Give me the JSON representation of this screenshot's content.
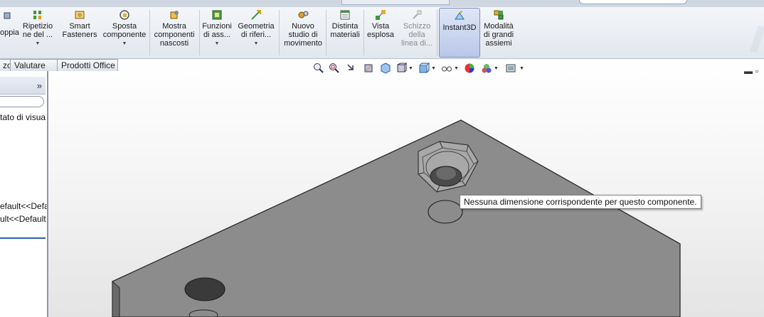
{
  "ribbon": {
    "buttons": [
      {
        "id": "accoppia",
        "label": "oppia"
      },
      {
        "id": "ripetizione",
        "label": "Ripetizio\nne del ..."
      },
      {
        "id": "smart-fasteners",
        "label": "Smart\nFasteners"
      },
      {
        "id": "sposta-componente",
        "label": "Sposta\ncomponente"
      },
      {
        "id": "mostra-componenti-nascosti",
        "label": "Mostra\ncomponenti\nnascosti"
      },
      {
        "id": "funzioni-assieme",
        "label": "Funzioni\ndi ass..."
      },
      {
        "id": "geometria-riferimento",
        "label": "Geometria\ndi riferi..."
      },
      {
        "id": "nuovo-studio-movimento",
        "label": "Nuovo\nstudio di\nmovimento"
      },
      {
        "id": "distinta-materiali",
        "label": "Distinta\nmateriali"
      },
      {
        "id": "vista-esplosa",
        "label": "Vista\nesplosa"
      },
      {
        "id": "schizzo-linea",
        "label": "Schizzo\ndella\nlinea di..."
      },
      {
        "id": "instant3d",
        "label": "Instant3D"
      },
      {
        "id": "modalita-grandi-assiemi",
        "label": "Modalità\ndi grandi\nassiemi"
      }
    ]
  },
  "tabs": [
    {
      "label": "zo"
    },
    {
      "label": "Valutare"
    },
    {
      "label": "Prodotti Office"
    }
  ],
  "left_panel": {
    "more_glyph": "»",
    "lines": [
      {
        "text": "tato di visua"
      },
      {
        "text": "efault<<Defa"
      },
      {
        "text": "ult<<Default"
      }
    ]
  },
  "tooltip": {
    "text": "Nessuna dimensione corrispondente per questo componente."
  },
  "colors": {
    "accent": "#2c5fb8",
    "ribbon_active": "#b9c7e8",
    "model_top": "#8d8d8d"
  }
}
